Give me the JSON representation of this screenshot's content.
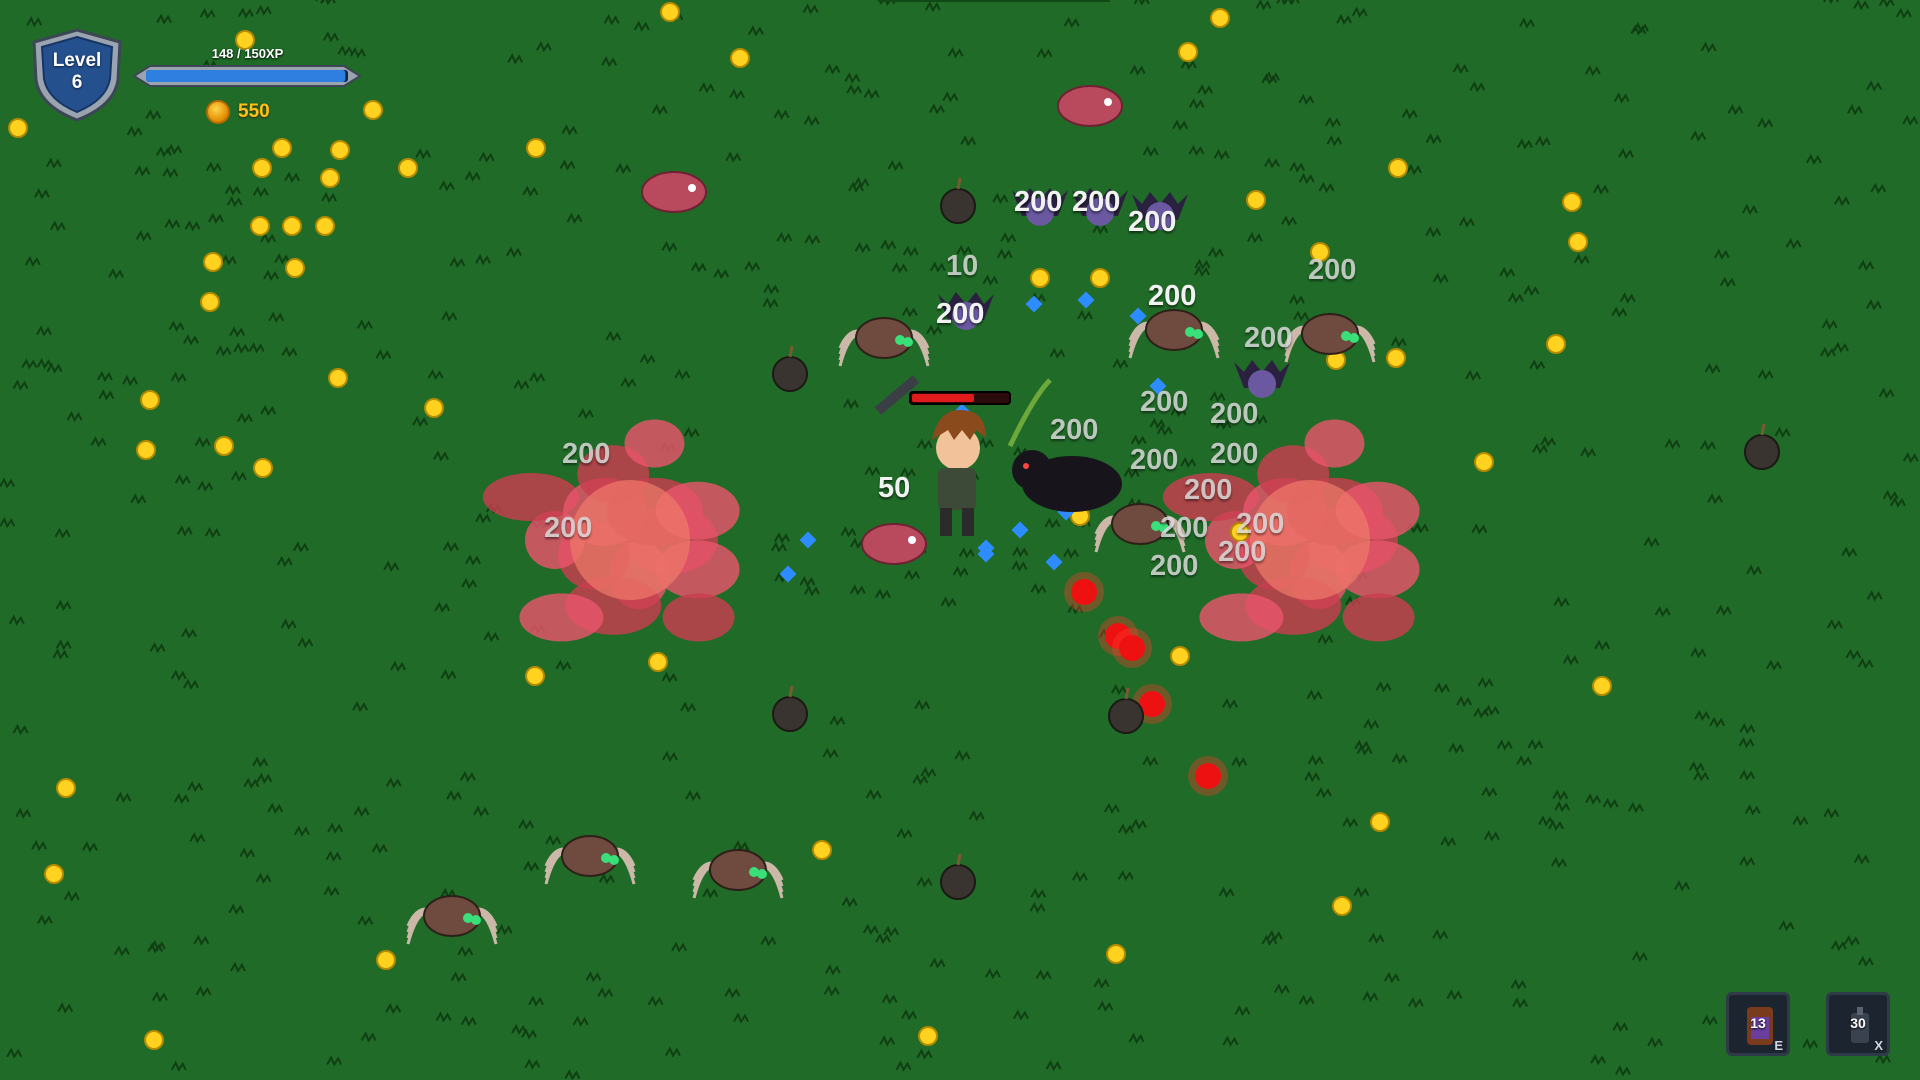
{
  "hud": {
    "level_label": "Level",
    "level_value": "6",
    "xp_text": "148 / 150XP",
    "xp_progress": 0.987,
    "gold": "550"
  },
  "inventory": [
    {
      "name": "potion-slot",
      "count": "13",
      "key": "E",
      "icon": "potion-icon"
    },
    {
      "name": "bomb-slot",
      "count": "30",
      "key": "X",
      "icon": "bomb-icon"
    }
  ],
  "damage_numbers": [
    "200",
    "200",
    "200",
    "10",
    "200",
    "200",
    "200",
    "200",
    "200",
    "200",
    "200",
    "50",
    "200",
    "200",
    "200",
    "200",
    "200",
    "200",
    "200",
    "200",
    "200"
  ],
  "colors": {
    "grass": "#1f6b27",
    "coin": "#ffd21f",
    "xp_gem": "#2d8cff",
    "explosion": "#e8556a",
    "health_bar": "#e01b1b"
  }
}
